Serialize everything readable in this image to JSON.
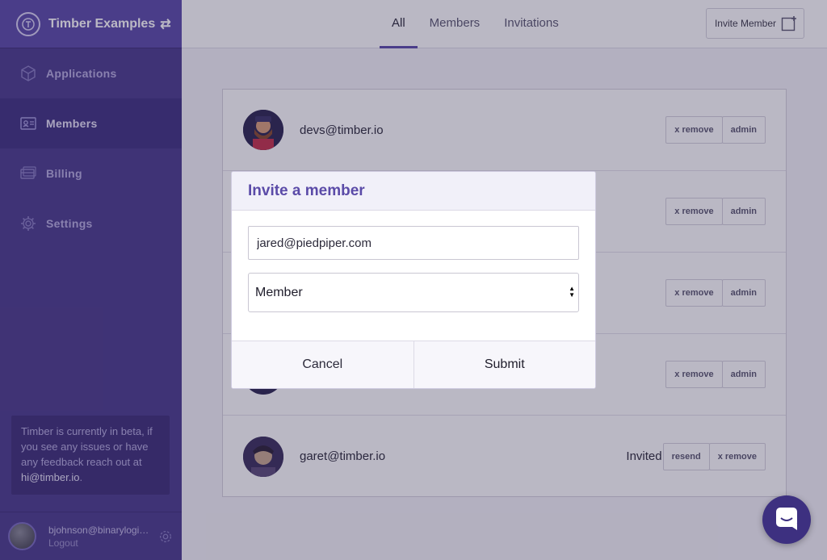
{
  "sidebar": {
    "org_name": "Timber Examples",
    "items": [
      {
        "label": "Applications",
        "icon": "cube-icon"
      },
      {
        "label": "Members",
        "icon": "id-card-icon"
      },
      {
        "label": "Billing",
        "icon": "credit-card-icon"
      },
      {
        "label": "Settings",
        "icon": "gear-icon"
      }
    ],
    "beta_note_prefix": "Timber is currently in beta, if you see any issues or have any feedback reach out at ",
    "beta_note_email": "hi@timber.io",
    "beta_note_suffix": ".",
    "user_email": "bjohnson@binarylogic.com",
    "logout_label": "Logout"
  },
  "topbar": {
    "tabs": [
      "All",
      "Members",
      "Invitations"
    ],
    "active_tab": "All",
    "invite_button": "Invite Member"
  },
  "members": {
    "rows": [
      {
        "email": "devs@timber.io",
        "status": "",
        "actions": [
          "x remove",
          "admin"
        ]
      },
      {
        "email": "",
        "status": "",
        "actions": [
          "x remove",
          "admin"
        ]
      },
      {
        "email": "",
        "status": "",
        "actions": [
          "x remove",
          "admin"
        ]
      },
      {
        "email": "",
        "status": "",
        "actions": [
          "x remove",
          "admin"
        ]
      },
      {
        "email": "garet@timber.io",
        "status": "Invited",
        "actions": [
          "resend",
          "x remove"
        ]
      }
    ]
  },
  "modal": {
    "title": "Invite a member",
    "email_value": "jared@piedpiper.com",
    "role_value": "Member",
    "cancel_label": "Cancel",
    "submit_label": "Submit"
  },
  "colors": {
    "sidebar": "#4b3b8c",
    "accent": "#5b4ba8",
    "overlay": "rgba(40,34,70,0.32)"
  }
}
